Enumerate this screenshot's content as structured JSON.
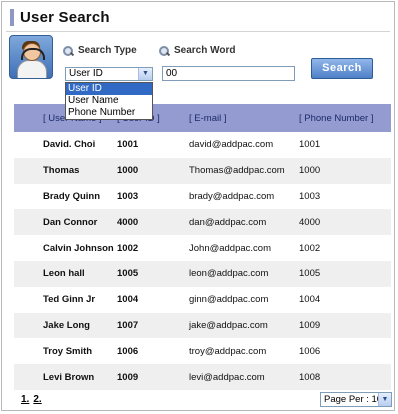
{
  "page": {
    "title": "User Search"
  },
  "search": {
    "type_label": "Search Type",
    "word_label": "Search Word",
    "type_selected": "User ID",
    "type_options": [
      "User ID",
      "User Name",
      "Phone Number"
    ],
    "word_value": "00",
    "button_label": "Search"
  },
  "table": {
    "headers": [
      "[ User Name ]",
      "[ User ID ]",
      "[ E-mail ]",
      "[ Phone Number ]"
    ],
    "rows": [
      [
        "David. Choi",
        "1001",
        "david@addpac.com",
        "1001"
      ],
      [
        "Thomas",
        "1000",
        "Thomas@addpac.com",
        "1000"
      ],
      [
        "Brady Quinn",
        "1003",
        "brady@addpac.com",
        "1003"
      ],
      [
        "Dan Connor",
        "4000",
        "dan@addpac.com",
        "4000"
      ],
      [
        "Calvin Johnson",
        "1002",
        "John@addpac.com",
        "1002"
      ],
      [
        "Leon hall",
        "1005",
        "leon@addpac.com",
        "1005"
      ],
      [
        "Ted Ginn Jr",
        "1004",
        "ginn@addpac.com",
        "1004"
      ],
      [
        "Jake Long",
        "1007",
        "jake@addpac.com",
        "1009"
      ],
      [
        "Troy Smith",
        "1006",
        "troy@addpac.com",
        "1006"
      ],
      [
        "Levi Brown",
        "1009",
        "levi@addpac.com",
        "1008"
      ]
    ]
  },
  "pager": {
    "pages": [
      "1.",
      "2."
    ],
    "page_per": "Page Per : 10"
  },
  "icons": {
    "avatar": "user-headset-icon",
    "search": "magnifier-icon",
    "dropdown": "chevron-down-icon"
  },
  "colors": {
    "header_bg": "#939bd0",
    "accent": "#8f97c5",
    "button": "#4f81c8",
    "selected_option": "#316ac5"
  }
}
